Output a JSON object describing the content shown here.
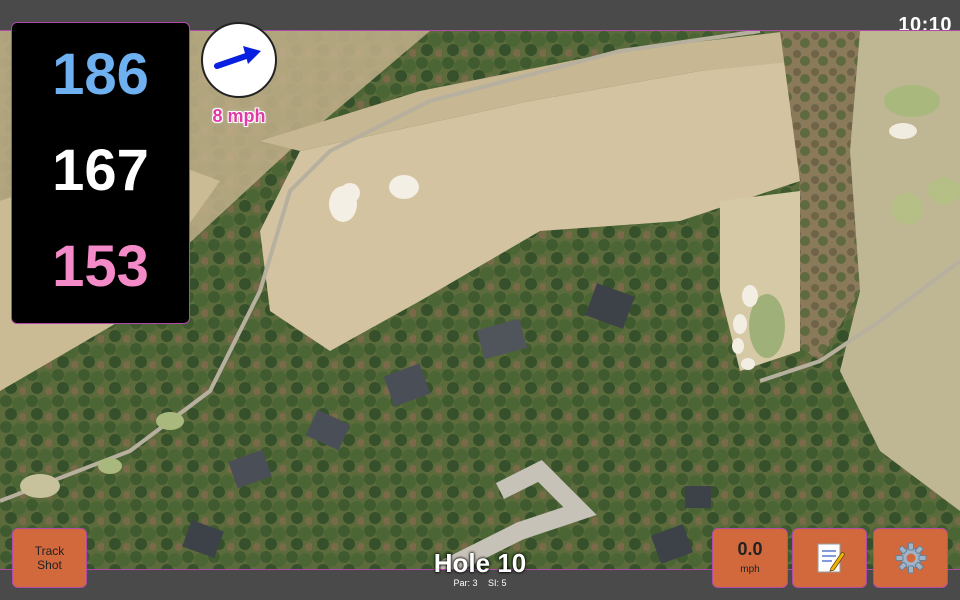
{
  "status": {
    "time": "10:10"
  },
  "distances": {
    "back": "186",
    "middle": "167",
    "front": "153"
  },
  "wind": {
    "speed": "8 mph",
    "icon": "wind-arrow-icon"
  },
  "buttons": {
    "track_shot": [
      "Track",
      "Shot"
    ],
    "speed_value": "0.0",
    "speed_unit": "mph",
    "notes_icon": "memo-icon",
    "settings_icon": "gear-icon"
  },
  "hole": {
    "title": "Hole 10",
    "par": "Par: 3",
    "si": "SI: 5"
  },
  "colors": {
    "back": "#6fb0f0",
    "middle": "#ffffff",
    "front": "#f58ac8",
    "button": "#d2693c",
    "accent": "#b04aa8"
  }
}
